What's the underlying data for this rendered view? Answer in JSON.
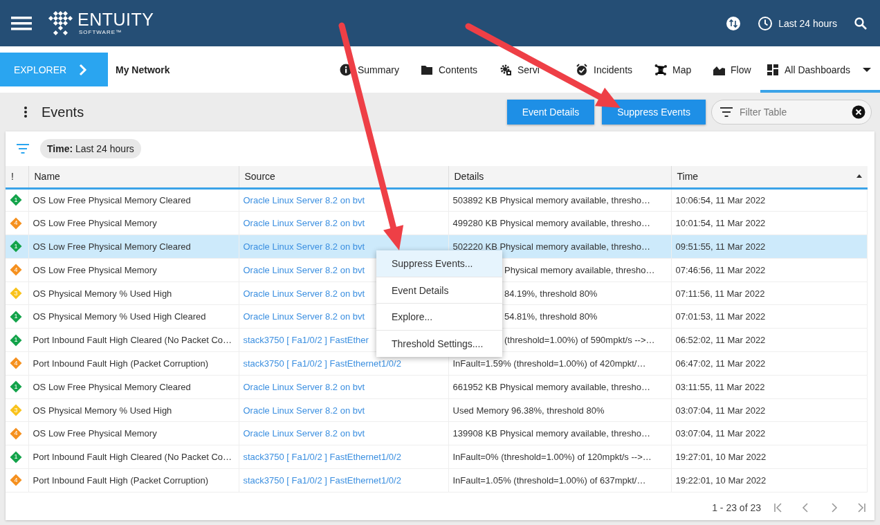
{
  "top_bar": {
    "logo": {
      "name": "ENTUITY",
      "tagline": "SOFTWARE™"
    },
    "time_range": "Last 24 hours"
  },
  "nav": {
    "explorer": "EXPLORER",
    "context": "My Network",
    "tabs": [
      {
        "label": "Summary",
        "kind": "info",
        "selected": false,
        "dropdown": false
      },
      {
        "label": "Contents",
        "kind": "folder",
        "selected": false,
        "dropdown": false
      },
      {
        "label": "Servi",
        "kind": "gear",
        "selected": false,
        "dropdown": false
      },
      {
        "label": "Incidents",
        "kind": "alarm",
        "selected": false,
        "dropdown": false
      },
      {
        "label": "Map",
        "kind": "nodes",
        "selected": false,
        "dropdown": false
      },
      {
        "label": "Flow",
        "kind": "chart",
        "selected": false,
        "dropdown": false
      },
      {
        "label": "All Dashboards",
        "kind": "grid",
        "selected": true,
        "dropdown": true
      }
    ]
  },
  "page": {
    "title": "Events",
    "buttons": [
      "Event Details",
      "Suppress Events"
    ],
    "filter": {
      "placeholder": "Filter Table"
    }
  },
  "filter_chip": "**Time:** Last 24 hours",
  "table": {
    "columns": [
      {
        "label": "!",
        "sorted": false
      },
      {
        "label": "Name",
        "sorted": false
      },
      {
        "label": "Source",
        "sorted": false
      },
      {
        "label": "Details",
        "sorted": false
      },
      {
        "label": "Time",
        "sorted": true
      }
    ],
    "rows": [
      {
        "severity": "1",
        "color": "#13a34a",
        "name": "OS Low Free Physical Memory Cleared",
        "source": "Oracle Linux Server 8.2 on bvt",
        "details": "503892 KB Physical memory available, thresho…",
        "time": "10:06:54, 11 Mar 2022",
        "selected": false
      },
      {
        "severity": "4",
        "color": "#f5901e",
        "name": "OS Low Free Physical Memory",
        "source": "Oracle Linux Server 8.2 on bvt",
        "details": "499280 KB Physical memory available, thresho…",
        "time": "10:01:54, 11 Mar 2022",
        "selected": false
      },
      {
        "severity": "1",
        "color": "#13a34a",
        "name": "OS Low Free Physical Memory Cleared",
        "source": "Oracle Linux Server 8.2 on bvt",
        "details": "502220 KB Physical memory available, thresho…",
        "time": "09:51:55, 11 Mar 2022",
        "selected": true
      },
      {
        "severity": "4",
        "color": "#f5901e",
        "name": "OS Low Free Physical Memory",
        "source": "Oracle Linux Server 8.2 on bvt",
        "details": "Physical memory available, thresho…",
        "time": "07:46:56, 11 Mar 2022",
        "selected": false
      },
      {
        "severity": "3",
        "color": "#f9c21b",
        "name": "OS Physical Memory % Used High",
        "source": "Oracle Linux Server 8.2 on bvt",
        "details": "84.19%, threshold 80%",
        "time": "07:11:56, 11 Mar 2022",
        "selected": false
      },
      {
        "severity": "1",
        "color": "#13a34a",
        "name": "OS Physical Memory % Used High Cleared",
        "source": "Oracle Linux Server 8.2 on bvt",
        "details": "54.81%, threshold 80%",
        "time": "07:01:53, 11 Mar 2022",
        "selected": false
      },
      {
        "severity": "1",
        "color": "#13a34a",
        "name": "Port Inbound Fault High Cleared (No Packet Co…",
        "source": "stack3750 [ Fa1/0/2 ] FastEther",
        "details": "(threshold=1.00%) of 590mpkt/s -->…",
        "time": "06:52:02, 11 Mar 2022",
        "selected": false
      },
      {
        "severity": "4",
        "color": "#f5901e",
        "name": "Port Inbound Fault High (Packet Corruption)",
        "source": "stack3750 [ Fa1/0/2 ] FastEthernet1/0/2",
        "details": "InFault=1.59% (threshold=1.00%) of 420mpkt/…",
        "time": "06:47:02, 11 Mar 2022",
        "selected": false
      },
      {
        "severity": "1",
        "color": "#13a34a",
        "name": "OS Low Free Physical Memory Cleared",
        "source": "Oracle Linux Server 8.2 on bvt",
        "details": "661952 KB Physical memory available, thresho…",
        "time": "03:11:55, 11 Mar 2022",
        "selected": false
      },
      {
        "severity": "3",
        "color": "#f9c21b",
        "name": "OS Physical Memory % Used High",
        "source": "Oracle Linux Server 8.2 on bvt",
        "details": "Used Memory 96.38%, threshold 80%",
        "time": "03:07:04, 11 Mar 2022",
        "selected": false
      },
      {
        "severity": "4",
        "color": "#f5901e",
        "name": "OS Low Free Physical Memory",
        "source": "Oracle Linux Server 8.2 on bvt",
        "details": "139908 KB Physical memory available, thresho…",
        "time": "03:07:04, 11 Mar 2022",
        "selected": false
      },
      {
        "severity": "1",
        "color": "#13a34a",
        "name": "Port Inbound Fault High Cleared (No Packet Co…",
        "source": "stack3750 [ Fa1/0/2 ] FastEthernet1/0/2",
        "details": "InFault=0% (threshold=1.00%) of 120mpkt/s -->…",
        "time": "19:27:01, 10 Mar 2022",
        "selected": false
      },
      {
        "severity": "4",
        "color": "#f5901e",
        "name": "Port Inbound Fault High (Packet Corruption)",
        "source": "stack3750 [ Fa1/0/2 ] FastEthernet1/0/2",
        "details": "InFault=1.05% (threshold=1.00%) of 637mpkt/…",
        "time": "19:22:01, 10 Mar 2022",
        "selected": false
      }
    ],
    "pagination": "1 - 23 of 23"
  },
  "context_menu": [
    {
      "label": "Suppress Events...",
      "hovered": true
    },
    {
      "label": "Event Details",
      "hovered": false
    },
    {
      "label": "Explore...",
      "hovered": false
    },
    {
      "label": "Threshold Settings....",
      "hovered": false
    }
  ]
}
